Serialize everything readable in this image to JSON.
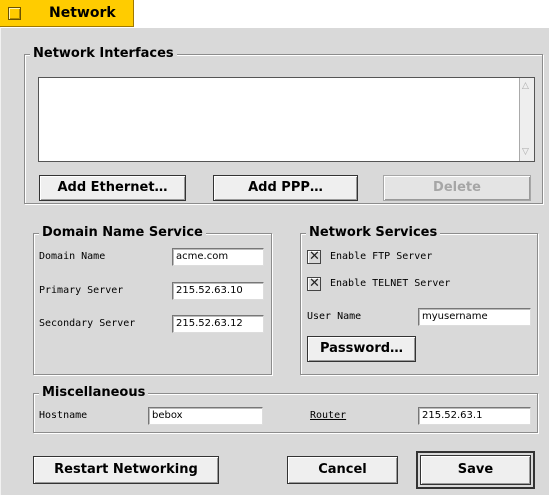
{
  "tab": {
    "title": "Network"
  },
  "interfaces": {
    "legend": "Network Interfaces",
    "add_ethernet_label": "Add Ethernet…",
    "add_ppp_label": "Add PPP…",
    "delete_label": "Delete"
  },
  "dns": {
    "legend": "Domain Name Service",
    "domain_name_label": "Domain Name",
    "domain_name_value": "acme.com",
    "primary_label": "Primary Server",
    "primary_value": "215.52.63.10",
    "secondary_label": "Secondary Server",
    "secondary_value": "215.52.63.12"
  },
  "services": {
    "legend": "Network Services",
    "ftp_label": "Enable FTP Server",
    "telnet_label": "Enable TELNET Server",
    "username_label": "User Name",
    "username_value": "myusername",
    "password_label": "Password…"
  },
  "misc": {
    "legend": "Miscellaneous",
    "hostname_label": "Hostname",
    "hostname_value": "bebox",
    "router_label": "Router",
    "router_value": "215.52.63.1"
  },
  "footer": {
    "restart_label": "Restart Networking",
    "cancel_label": "Cancel",
    "save_label": "Save"
  }
}
